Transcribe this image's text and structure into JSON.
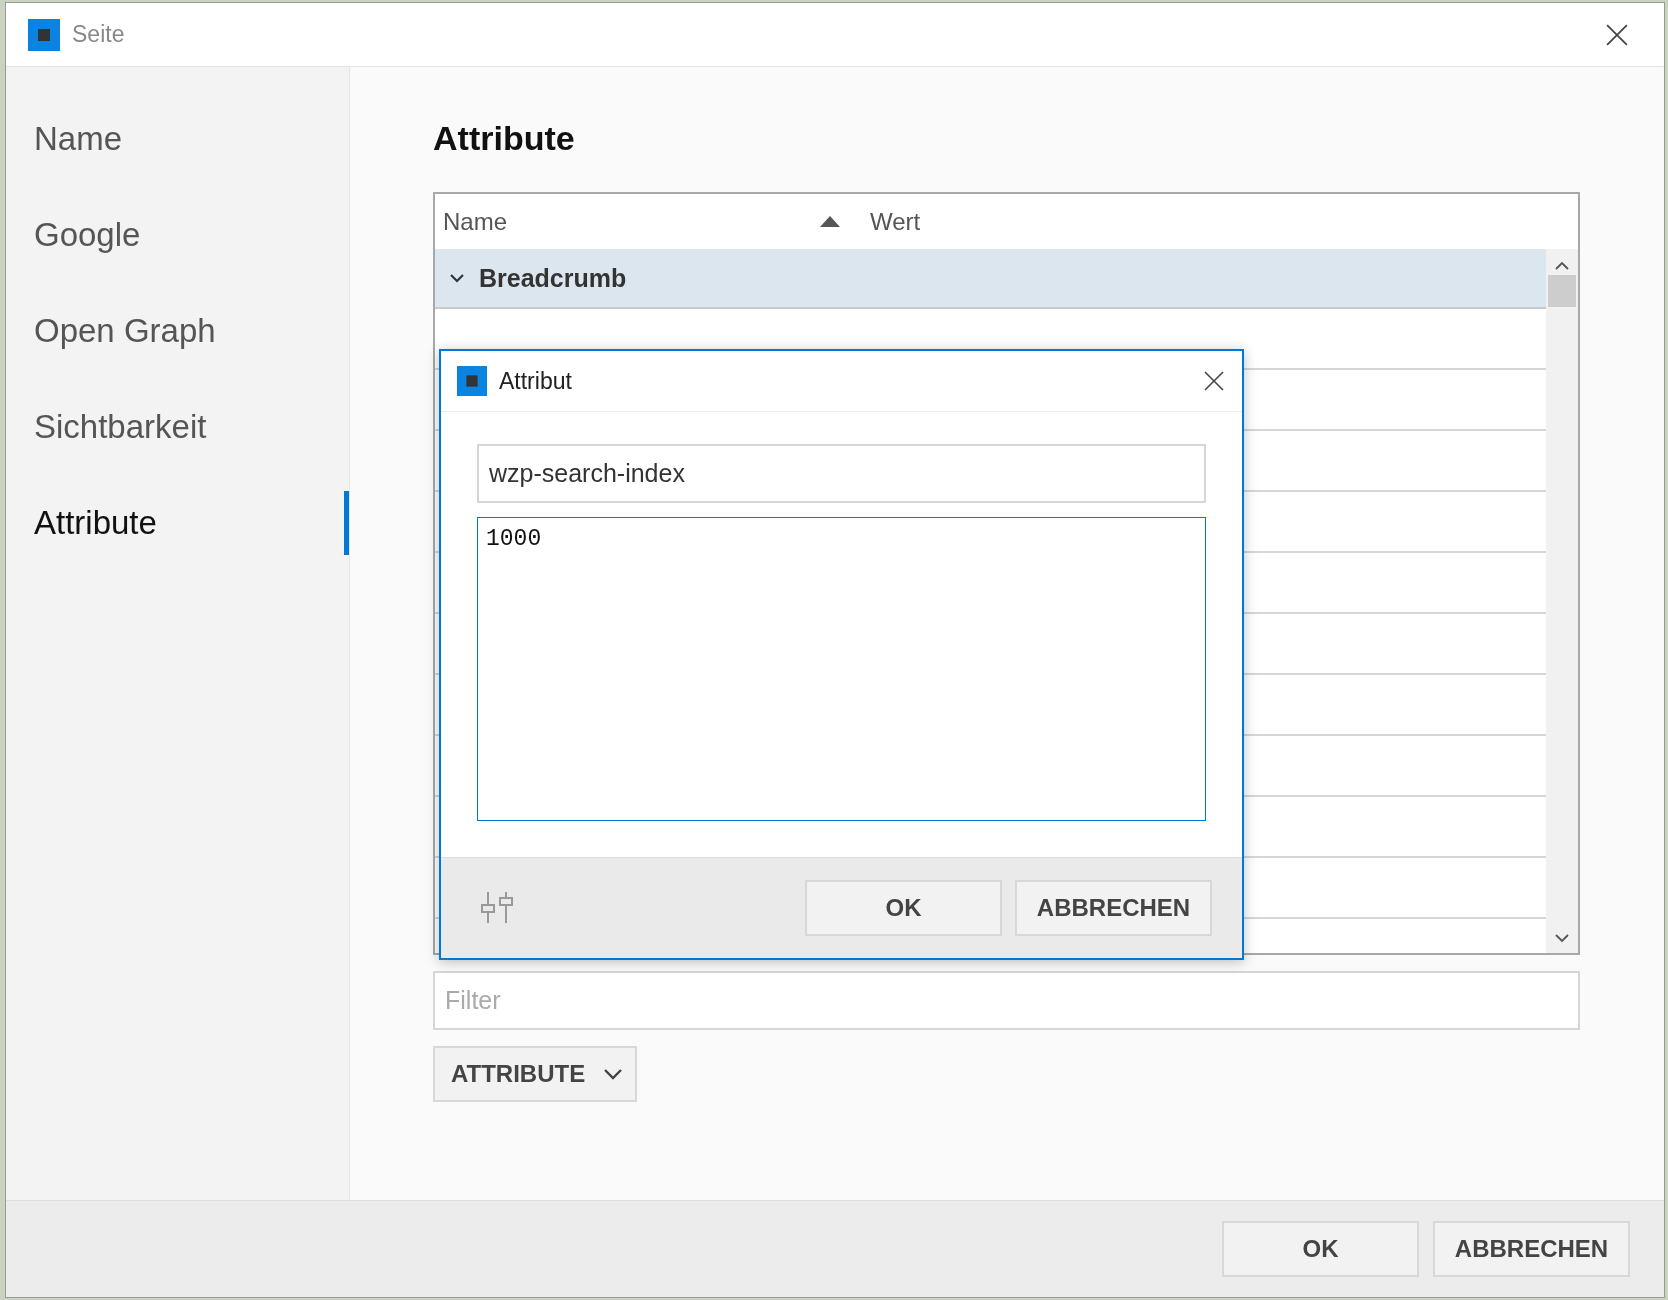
{
  "window": {
    "title": "Seite"
  },
  "sidebar": {
    "items": [
      {
        "label": "Name",
        "selected": false
      },
      {
        "label": "Google",
        "selected": false
      },
      {
        "label": "Open Graph",
        "selected": false
      },
      {
        "label": "Sichtbarkeit",
        "selected": false
      },
      {
        "label": "Attribute",
        "selected": true
      }
    ]
  },
  "content": {
    "heading": "Attribute",
    "table": {
      "columns": [
        {
          "label": "Name",
          "sorted": true
        },
        {
          "label": "Wert",
          "sorted": false
        }
      ],
      "groups": [
        {
          "label": "Breadcrumb",
          "expanded": true
        }
      ]
    },
    "filter": {
      "placeholder": "Filter"
    },
    "type_button": {
      "label": "ATTRIBUTE"
    }
  },
  "buttons": [
    "OK",
    "ABBRECHEN"
  ],
  "dialog": {
    "title": "Attribut",
    "name_field": {
      "value": "wzp-search-index"
    },
    "value_field": {
      "value": "1000"
    },
    "buttons": [
      "OK",
      "ABBRECHEN"
    ]
  }
}
